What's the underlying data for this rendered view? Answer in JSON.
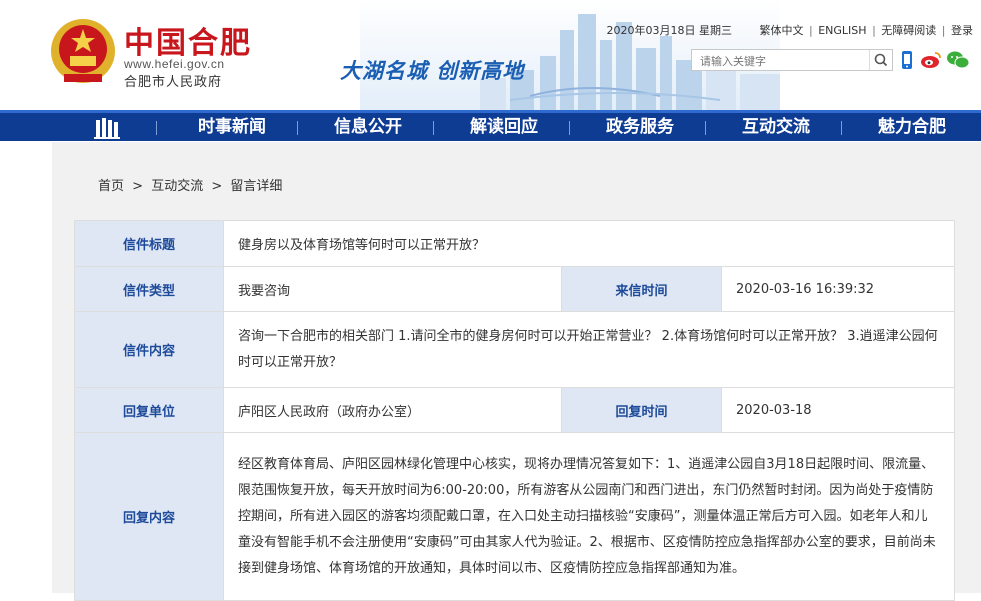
{
  "header": {
    "logo_cn": "中国合肥",
    "logo_url": "www.hefei.gov.cn",
    "logo_gov": "合肥市人民政府",
    "slogan": "大湖名城  创新高地",
    "date": "2020年03月18日 星期三",
    "links": [
      "繁体中文",
      "ENGLISH",
      "无障碍阅读",
      "登录"
    ],
    "search_placeholder": "请输入关键字",
    "icons": [
      "search-icon",
      "mobile-icon",
      "weibo-icon",
      "wechat-icon"
    ]
  },
  "nav": {
    "items": [
      "时事新闻",
      "信息公开",
      "解读回应",
      "政务服务",
      "互动交流",
      "魅力合肥"
    ]
  },
  "breadcrumb": [
    "首页",
    ">",
    "互动交流",
    ">",
    "留言详细"
  ],
  "detail": {
    "title_label": "信件标题",
    "title_value": "健身房以及体育场馆等何时可以正常开放？",
    "type_label": "信件类型",
    "type_value": "我要咨询",
    "time_label": "来信时间",
    "time_value": "2020-03-16 16:39:32",
    "content_label": "信件内容",
    "content_value": "咨询一下合肥市的相关部门 1.请问全市的健身房何时可以开始正常营业？ 2.体育场馆何时可以正常开放？ 3.逍遥津公园何时可以正常开放？",
    "reply_unit_label": "回复单位",
    "reply_unit_value": "庐阳区人民政府（政府办公室）",
    "reply_time_label": "回复时间",
    "reply_time_value": "2020-03-18",
    "reply_content_label": "回复内容",
    "reply_content_value": "经区教育体育局、庐阳区园林绿化管理中心核实，现将办理情况答复如下：1、逍遥津公园自3月18日起限时间、限流量、限范围恢复开放，每天开放时间为6:00-20:00，所有游客从公园南门和西门进出，东门仍然暂时封闭。因为尚处于疫情防控期间，所有进入园区的游客均须配戴口罩，在入口处主动扫描核验“安康码”，测量体温正常后方可入园。如老年人和儿童没有智能手机不会注册使用“安康码”可由其家人代为验证。2、根据市、区疫情防控应急指挥部办公室的要求，目前尚未接到健身场馆、体育场馆的开放通知，具体时间以市、区疫情防控应急指挥部通知为准。"
  },
  "colors": {
    "nav_bg": "#0f3c93",
    "brand_red": "#c8161d",
    "label_bg": "#dfe7f4",
    "label_text": "#1d4a9a"
  }
}
